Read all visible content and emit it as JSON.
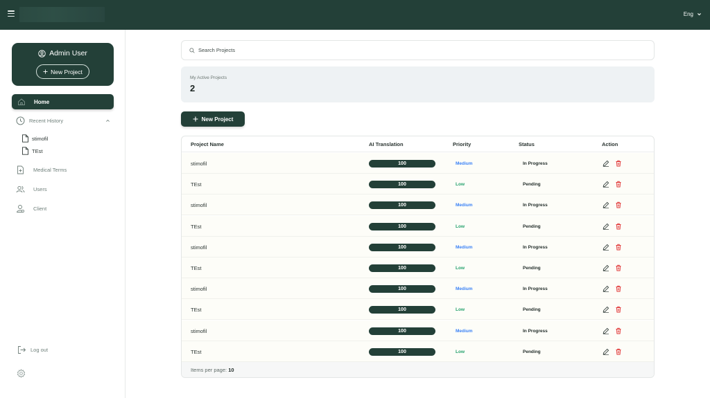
{
  "header": {
    "language": "Eng"
  },
  "sidebar": {
    "profile": {
      "name": "Admin User",
      "new_project_label": "New Project"
    },
    "home_label": "Home",
    "recent_history_label": "Recent History",
    "recent_items": [
      "stimofil",
      "TEst"
    ],
    "medical_terms_label": "Medical Terms",
    "users_label": "Users",
    "client_label": "Client",
    "logout_label": "Log out"
  },
  "main": {
    "search_placeholder": "Search Projects",
    "active_projects_label": "My Active Projects",
    "active_projects_count": "2",
    "new_project_label": "New Project",
    "table": {
      "headers": {
        "name": "Project Name",
        "ai": "AI Translation",
        "priority": "Priority",
        "status": "Status",
        "action": "Action"
      },
      "rows": [
        {
          "name": "stimofil",
          "ai": "100",
          "priority": "Medium",
          "status": "In Progress"
        },
        {
          "name": "TEst",
          "ai": "100",
          "priority": "Low",
          "status": "Pending"
        },
        {
          "name": "stimofil",
          "ai": "100",
          "priority": "Medium",
          "status": "In Progress"
        },
        {
          "name": "TEst",
          "ai": "100",
          "priority": "Low",
          "status": "Pending"
        },
        {
          "name": "stimofil",
          "ai": "100",
          "priority": "Medium",
          "status": "In Progress"
        },
        {
          "name": "TEst",
          "ai": "100",
          "priority": "Low",
          "status": "Pending"
        },
        {
          "name": "stimofil",
          "ai": "100",
          "priority": "Medium",
          "status": "In Progress"
        },
        {
          "name": "TEst",
          "ai": "100",
          "priority": "Low",
          "status": "Pending"
        },
        {
          "name": "stimofil",
          "ai": "100",
          "priority": "Medium",
          "status": "In Progress"
        },
        {
          "name": "TEst",
          "ai": "100",
          "priority": "Low",
          "status": "Pending"
        }
      ],
      "footer": {
        "label": "Items per page:",
        "value": "10"
      }
    }
  },
  "colors": {
    "brand": "#234038",
    "medium": "#3b82f6",
    "low": "#22a06b",
    "delete": "#e03131"
  },
  "icons": [
    "menu-icon",
    "chevron-down-icon",
    "user-circle-icon",
    "plus-icon",
    "home-icon",
    "clock-icon",
    "file-icon",
    "document-plus-icon",
    "users-icon",
    "client-icon",
    "logout-icon",
    "gear-icon",
    "search-icon",
    "edit-icon",
    "trash-icon"
  ]
}
